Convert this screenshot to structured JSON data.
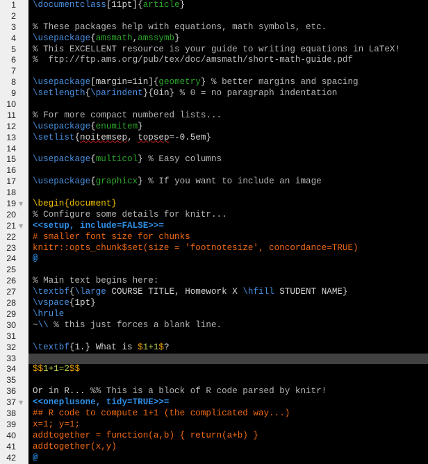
{
  "editor": {
    "active_line": 33,
    "colors": {
      "background": "#000000",
      "gutter": "#efefef",
      "active_line": "#414141",
      "command": "#4a90e0",
      "argument": "#2da62d",
      "text": "#d6d6d6",
      "comment": "#b8b8b8",
      "environment": "#f0c000",
      "chunk_header": "#2e8fe8",
      "r_code": "#f06a14",
      "math_delim": "#f0a000",
      "math": "#b6d24a"
    },
    "lines": [
      {
        "n": "1",
        "fold": "",
        "tokens": [
          {
            "c": "t-cmd",
            "t": "\\documentclass"
          },
          {
            "c": "t-plain",
            "t": "[11pt]{"
          },
          {
            "c": "t-arg",
            "t": "article"
          },
          {
            "c": "t-plain",
            "t": "}"
          }
        ]
      },
      {
        "n": "2",
        "fold": "",
        "tokens": []
      },
      {
        "n": "3",
        "fold": "",
        "tokens": [
          {
            "c": "t-cmt",
            "t": "% These packages help with equations, math symbols, etc."
          }
        ]
      },
      {
        "n": "4",
        "fold": "",
        "tokens": [
          {
            "c": "t-cmd",
            "t": "\\usepackage"
          },
          {
            "c": "t-plain",
            "t": "{"
          },
          {
            "c": "t-arg",
            "t": "amsmath"
          },
          {
            "c": "t-plain",
            "t": ","
          },
          {
            "c": "t-arg",
            "t": "amssymb"
          },
          {
            "c": "t-plain",
            "t": "}"
          }
        ]
      },
      {
        "n": "5",
        "fold": "",
        "tokens": [
          {
            "c": "t-cmt",
            "t": "% This EXCELLENT resource is your guide to writing equations in LaTeX!"
          }
        ]
      },
      {
        "n": "6",
        "fold": "",
        "tokens": [
          {
            "c": "t-cmt",
            "t": "%  ftp://ftp.ams.org/pub/tex/doc/amsmath/short-math-guide.pdf"
          }
        ]
      },
      {
        "n": "7",
        "fold": "",
        "tokens": []
      },
      {
        "n": "8",
        "fold": "",
        "tokens": [
          {
            "c": "t-cmd",
            "t": "\\usepackage"
          },
          {
            "c": "t-plain",
            "t": "[margin=1in]{"
          },
          {
            "c": "t-arg",
            "t": "geometry"
          },
          {
            "c": "t-plain",
            "t": "} "
          },
          {
            "c": "t-cmt",
            "t": "% better margins and spacing"
          }
        ]
      },
      {
        "n": "9",
        "fold": "",
        "tokens": [
          {
            "c": "t-cmd",
            "t": "\\setlength"
          },
          {
            "c": "t-plain",
            "t": "{"
          },
          {
            "c": "t-cmd",
            "t": "\\parindent"
          },
          {
            "c": "t-plain",
            "t": "}{0in} "
          },
          {
            "c": "t-cmt",
            "t": "% 0 = no paragraph indentation"
          }
        ]
      },
      {
        "n": "10",
        "fold": "",
        "tokens": []
      },
      {
        "n": "11",
        "fold": "",
        "tokens": [
          {
            "c": "t-cmt",
            "t": "% For more compact numbered lists..."
          }
        ]
      },
      {
        "n": "12",
        "fold": "",
        "tokens": [
          {
            "c": "t-cmd",
            "t": "\\usepackage"
          },
          {
            "c": "t-plain",
            "t": "{"
          },
          {
            "c": "t-arg",
            "t": "enumitem"
          },
          {
            "c": "t-plain",
            "t": "}"
          }
        ]
      },
      {
        "n": "13",
        "fold": "",
        "tokens": [
          {
            "c": "t-cmd",
            "t": "\\setlist"
          },
          {
            "c": "t-plain",
            "t": "{"
          },
          {
            "c": "t-plain t-spell",
            "t": "noitemsep"
          },
          {
            "c": "t-plain",
            "t": ", "
          },
          {
            "c": "t-plain t-spell",
            "t": "topsep"
          },
          {
            "c": "t-plain",
            "t": "=-0.5em}"
          }
        ]
      },
      {
        "n": "14",
        "fold": "",
        "tokens": []
      },
      {
        "n": "15",
        "fold": "",
        "tokens": [
          {
            "c": "t-cmd",
            "t": "\\usepackage"
          },
          {
            "c": "t-plain",
            "t": "{"
          },
          {
            "c": "t-arg",
            "t": "multicol"
          },
          {
            "c": "t-plain",
            "t": "} "
          },
          {
            "c": "t-cmt",
            "t": "% Easy columns"
          }
        ]
      },
      {
        "n": "16",
        "fold": "",
        "tokens": []
      },
      {
        "n": "17",
        "fold": "",
        "tokens": [
          {
            "c": "t-cmd",
            "t": "\\usepackage"
          },
          {
            "c": "t-plain",
            "t": "{"
          },
          {
            "c": "t-arg",
            "t": "graphicx"
          },
          {
            "c": "t-plain",
            "t": "} "
          },
          {
            "c": "t-cmt",
            "t": "% If you want to include an image"
          }
        ]
      },
      {
        "n": "18",
        "fold": "",
        "tokens": []
      },
      {
        "n": "19",
        "fold": "▼",
        "tokens": [
          {
            "c": "t-env",
            "t": "\\begin{document}"
          }
        ]
      },
      {
        "n": "20",
        "fold": "",
        "tokens": [
          {
            "c": "t-cmt",
            "t": "% Configure some details for knitr..."
          }
        ]
      },
      {
        "n": "21",
        "fold": "▼",
        "tokens": [
          {
            "c": "t-chunk",
            "t": "<<setup, include=FALSE>>="
          }
        ]
      },
      {
        "n": "22",
        "fold": "",
        "tokens": [
          {
            "c": "t-r",
            "t": "# smaller font size for chunks"
          }
        ]
      },
      {
        "n": "23",
        "fold": "",
        "tokens": [
          {
            "c": "t-r",
            "t": "knitr::opts_chunk$set(size = 'footnotesize', concordance=TRUE)"
          }
        ]
      },
      {
        "n": "24",
        "fold": "",
        "tokens": [
          {
            "c": "t-chunk",
            "t": "@"
          }
        ]
      },
      {
        "n": "25",
        "fold": "",
        "tokens": []
      },
      {
        "n": "26",
        "fold": "",
        "tokens": [
          {
            "c": "t-cmt",
            "t": "% Main text begins here:"
          }
        ]
      },
      {
        "n": "27",
        "fold": "",
        "tokens": [
          {
            "c": "t-cmd",
            "t": "\\textbf"
          },
          {
            "c": "t-plain",
            "t": "{"
          },
          {
            "c": "t-cmd",
            "t": "\\large"
          },
          {
            "c": "t-plain",
            "t": " COURSE TITLE, Homework X "
          },
          {
            "c": "t-cmd",
            "t": "\\hfill"
          },
          {
            "c": "t-plain",
            "t": " STUDENT NAME}"
          }
        ]
      },
      {
        "n": "28",
        "fold": "",
        "tokens": [
          {
            "c": "t-cmd",
            "t": "\\vspace"
          },
          {
            "c": "t-plain",
            "t": "{1pt}"
          }
        ]
      },
      {
        "n": "29",
        "fold": "",
        "tokens": [
          {
            "c": "t-cmd",
            "t": "\\hrule"
          }
        ]
      },
      {
        "n": "30",
        "fold": "",
        "tokens": [
          {
            "c": "t-plain",
            "t": "~"
          },
          {
            "c": "t-cmd",
            "t": "\\\\"
          },
          {
            "c": "t-plain",
            "t": " "
          },
          {
            "c": "t-cmt",
            "t": "% this just forces a blank line."
          }
        ]
      },
      {
        "n": "31",
        "fold": "",
        "tokens": []
      },
      {
        "n": "32",
        "fold": "",
        "tokens": [
          {
            "c": "t-cmd",
            "t": "\\textbf"
          },
          {
            "c": "t-plain",
            "t": "{1.} What is "
          },
          {
            "c": "t-mathd",
            "t": "$"
          },
          {
            "c": "t-math",
            "t": "1+1"
          },
          {
            "c": "t-mathd",
            "t": "$"
          },
          {
            "c": "t-plain",
            "t": "?"
          }
        ]
      },
      {
        "n": "33",
        "fold": "",
        "tokens": []
      },
      {
        "n": "34",
        "fold": "",
        "tokens": [
          {
            "c": "t-mathd",
            "t": "$$"
          },
          {
            "c": "t-math",
            "t": "1+1=2"
          },
          {
            "c": "t-mathd",
            "t": "$$"
          }
        ]
      },
      {
        "n": "35",
        "fold": "",
        "tokens": []
      },
      {
        "n": "36",
        "fold": "",
        "tokens": [
          {
            "c": "t-plain",
            "t": "Or in R... "
          },
          {
            "c": "t-cmt",
            "t": "%% This is a block of R code parsed by knitr!"
          }
        ]
      },
      {
        "n": "37",
        "fold": "▼",
        "tokens": [
          {
            "c": "t-chunk",
            "t": "<<oneplusone, tidy=TRUE>>="
          }
        ]
      },
      {
        "n": "38",
        "fold": "",
        "tokens": [
          {
            "c": "t-r",
            "t": "## R code to compute 1+1 (the complicated way...)"
          }
        ]
      },
      {
        "n": "39",
        "fold": "",
        "tokens": [
          {
            "c": "t-r",
            "t": "x=1; y=1;"
          }
        ]
      },
      {
        "n": "40",
        "fold": "",
        "tokens": [
          {
            "c": "t-r",
            "t": "addtogether = function(a,b) { return(a+b) }"
          }
        ]
      },
      {
        "n": "41",
        "fold": "",
        "tokens": [
          {
            "c": "t-r",
            "t": "addtogether(x,y)"
          }
        ]
      },
      {
        "n": "42",
        "fold": "",
        "tokens": [
          {
            "c": "t-chunk",
            "t": "@"
          }
        ]
      }
    ]
  }
}
